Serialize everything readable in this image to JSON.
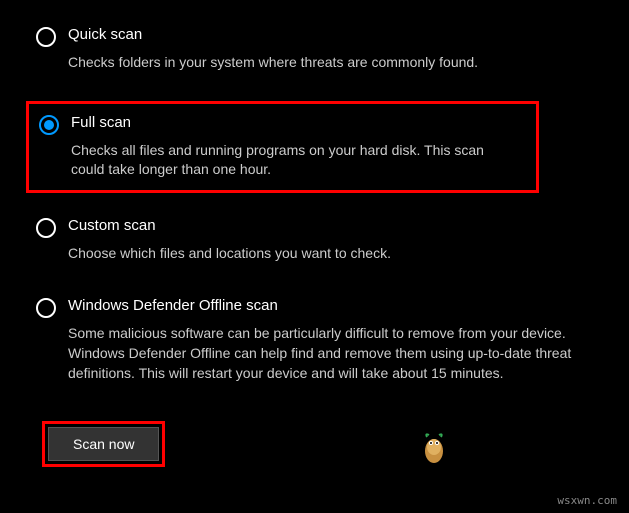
{
  "options": [
    {
      "title": "Quick scan",
      "desc": "Checks folders in your system where threats are commonly found.",
      "selected": false
    },
    {
      "title": "Full scan",
      "desc": "Checks all files and running programs on your hard disk. This scan could take longer than one hour.",
      "selected": true
    },
    {
      "title": "Custom scan",
      "desc": "Choose which files and locations you want to check.",
      "selected": false
    },
    {
      "title": "Windows Defender Offline scan",
      "desc": "Some malicious software can be particularly difficult to remove from your device. Windows Defender Offline can help find and remove them using up-to-date threat definitions. This will restart your device and will take about 15 minutes.",
      "selected": false
    }
  ],
  "button": {
    "label": "Scan now"
  },
  "watermark": "wsxwn.com"
}
